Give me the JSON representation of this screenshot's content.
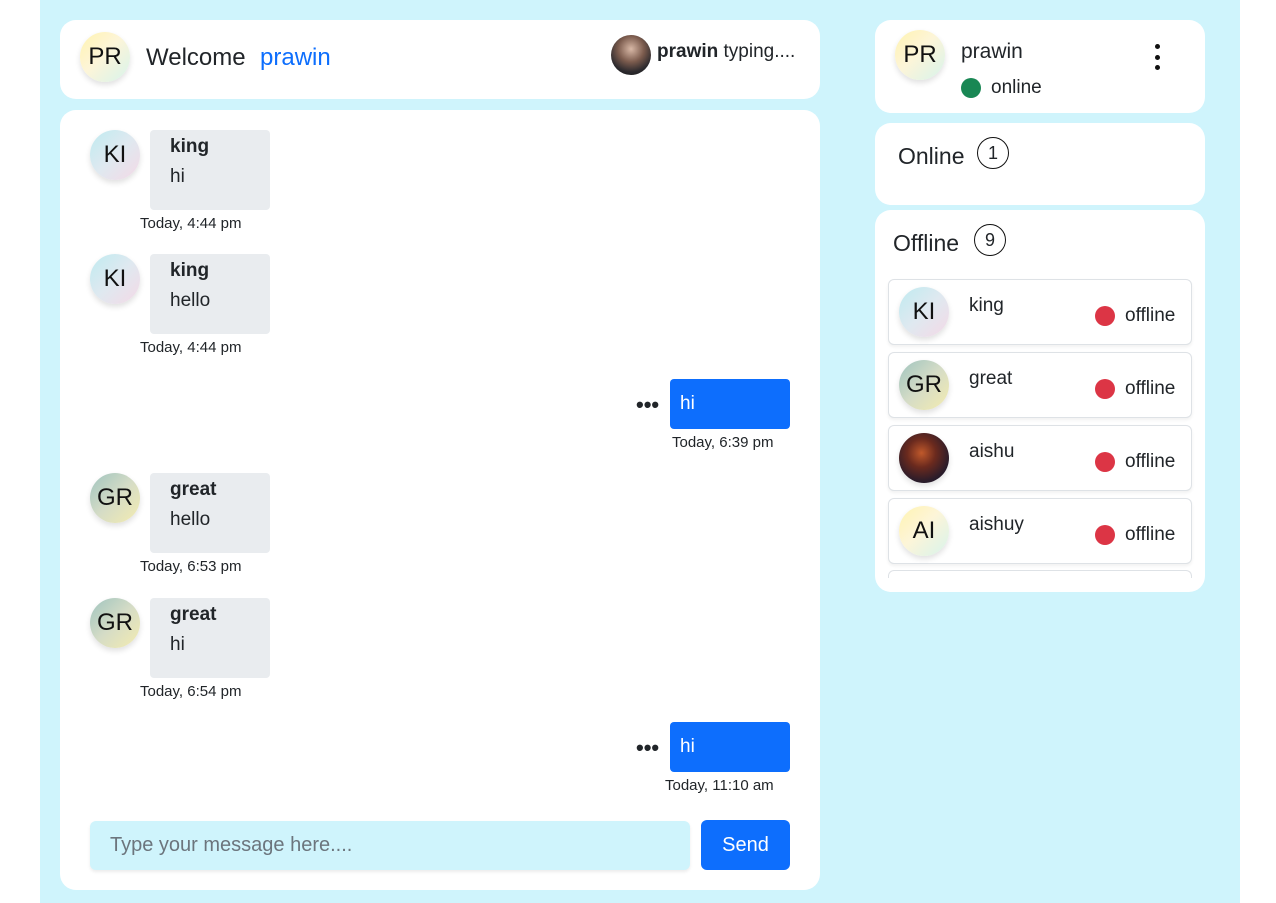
{
  "header": {
    "avatar_initials": "PR",
    "welcome_label": "Welcome",
    "username": "prawin",
    "typing_user": "prawin",
    "typing_text": "typing...."
  },
  "messages": [
    {
      "direction": "in",
      "initials": "KI",
      "sender": "king",
      "text": "hi",
      "time": "Today, 4:44 pm"
    },
    {
      "direction": "in",
      "initials": "KI",
      "sender": "king",
      "text": "hello",
      "time": "Today, 4:44 pm"
    },
    {
      "direction": "out",
      "text": "hi",
      "time": "Today, 6:39 pm",
      "menu": "•••"
    },
    {
      "direction": "in",
      "initials": "GR",
      "sender": "great",
      "text": "hello",
      "time": "Today, 6:53 pm"
    },
    {
      "direction": "in",
      "initials": "GR",
      "sender": "great",
      "text": "hi",
      "time": "Today, 6:54 pm"
    },
    {
      "direction": "out",
      "text": "hi",
      "time": "Today, 11:10 am",
      "menu": "•••"
    }
  ],
  "composer": {
    "placeholder": "Type your message here....",
    "send_label": "Send"
  },
  "profile": {
    "initials": "PR",
    "name": "prawin",
    "status": "online"
  },
  "online_section": {
    "title": "Online",
    "count": "1"
  },
  "offline_section": {
    "title": "Offline",
    "count": "9",
    "users": [
      {
        "initials": "KI",
        "name": "king",
        "status": "offline"
      },
      {
        "initials": "GR",
        "name": "great",
        "status": "offline"
      },
      {
        "initials": "",
        "name": "aishu",
        "status": "offline"
      },
      {
        "initials": "AI",
        "name": "aishuy",
        "status": "offline"
      }
    ]
  },
  "colors": {
    "accent": "#0d6efd",
    "background": "#cff4fc",
    "online": "#198754",
    "offline": "#dc3545"
  }
}
